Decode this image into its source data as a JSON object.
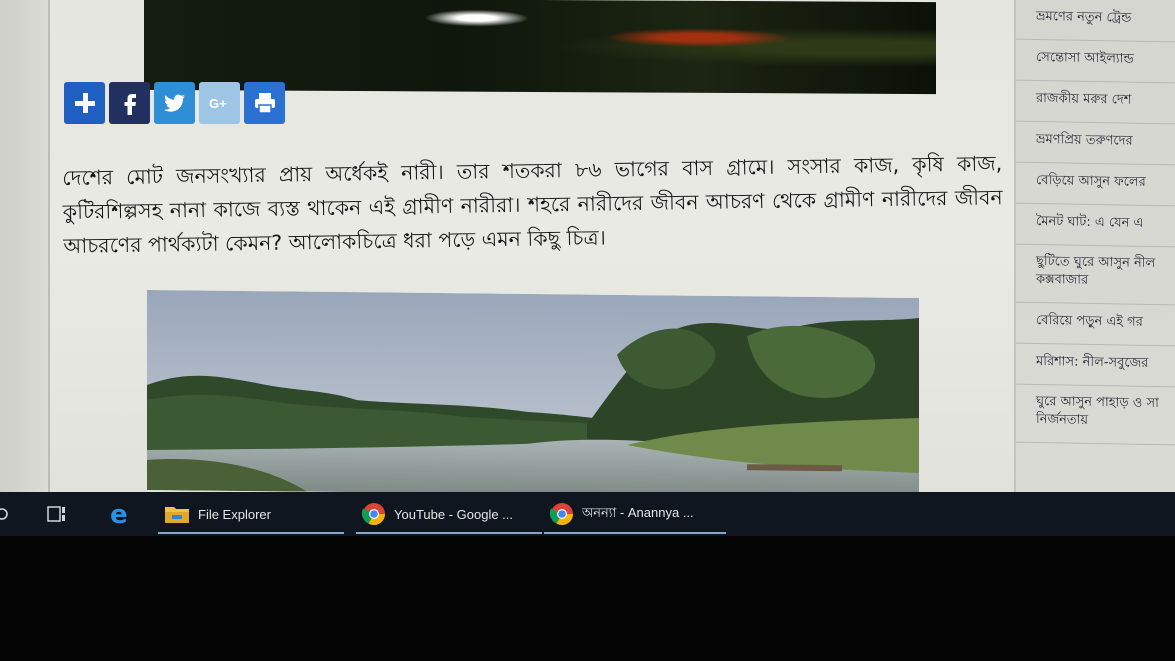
{
  "share_buttons": [
    {
      "name": "share-plus-icon",
      "glyph": "+"
    },
    {
      "name": "facebook-icon",
      "glyph": "f"
    },
    {
      "name": "twitter-icon",
      "glyph": "bird"
    },
    {
      "name": "google-plus-icon",
      "glyph": "G+"
    },
    {
      "name": "print-icon",
      "glyph": "printer"
    }
  ],
  "article": {
    "paragraph": "দেশের মোট জনসংখ্যার প্রায় অর্ধেকই নারী। তার শতকরা ৮৬ ভাগের বাস গ্রামে। সংসার কাজ, কৃষি কাজ, কুটিরশিল্পসহ নানা কাজে ব্যস্ত থাকেন এই গ্রামীণ নারীরা। শহরে নারীদের জীবন আচরণ থেকে গ্রামীণ নারীদের জীবন আচরণের পার্থক্যটা কেমন? আলোকচিত্রে ধরা পড়ে এমন কিছু চিত্র।"
  },
  "sidebar": {
    "items": [
      {
        "label": "ভ্রমণের নতুন ট্রেন্ড"
      },
      {
        "label": "সেন্তোসা আইল্যান্ড"
      },
      {
        "label": "রাজকীয় মরুর দেশ"
      },
      {
        "label": "ভ্রমণপ্রিয় তরুণদের"
      },
      {
        "label": "বেড়িয়ে আসুন ফলের"
      },
      {
        "label": "মৈনট ঘাট: এ যেন এ"
      },
      {
        "label": "ছুটিতে ঘুরে আসুন নীল কক্সবাজার"
      },
      {
        "label": "বেরিয়ে পড়ুন এই গর"
      },
      {
        "label": "মরিশাস: নীল-সবুজের"
      },
      {
        "label": "ঘুরে আসুন পাহাড় ও সা নির্জনতায়"
      }
    ]
  },
  "taskbar": {
    "apps": [
      {
        "label": "File Explorer"
      },
      {
        "label": "YouTube - Google ..."
      },
      {
        "label": "অনন্যা - Anannya ..."
      }
    ]
  },
  "colors": {
    "taskbar": "#0f1620",
    "share_blue": "#1f5fc2",
    "facebook": "#22305f",
    "twitter": "#2e8fd6",
    "google_plus": "#9dc5e6"
  }
}
